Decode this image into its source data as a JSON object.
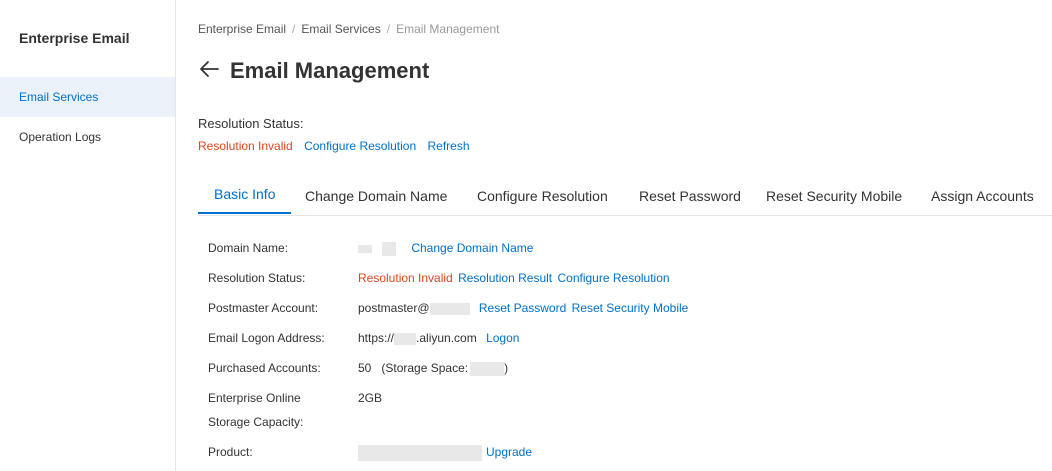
{
  "sidebar": {
    "title": "Enterprise Email",
    "items": [
      {
        "label": "Email Services"
      },
      {
        "label": "Operation Logs"
      }
    ]
  },
  "breadcrumb": [
    "Enterprise Email",
    "Email Services",
    "Email Management"
  ],
  "page": {
    "title": "Email Management"
  },
  "resolution": {
    "label": "Resolution Status:",
    "status": "Resolution Invalid",
    "configure": "Configure Resolution",
    "refresh": "Refresh"
  },
  "tabs": [
    "Basic Info",
    "Change Domain Name",
    "Configure Resolution",
    "Reset Password",
    "Reset Security Mobile",
    "Assign Accounts"
  ],
  "info": {
    "domain_label": "Domain Name:",
    "domain_action": "Change Domain Name",
    "res_label": "Resolution Status:",
    "res_status": "Resolution Invalid",
    "res_result": "Resolution Result",
    "res_configure": "Configure Resolution",
    "postmaster_label": "Postmaster Account:",
    "postmaster_prefix": "postmaster@",
    "reset_password": "Reset Password",
    "reset_mobile": "Reset Security Mobile",
    "logon_label": "Email Logon Address:",
    "logon_prefix": "https://",
    "logon_suffix": ".aliyun.com",
    "logon_action": "Logon",
    "purchased_label": "Purchased Accounts:",
    "purchased_count": "50",
    "storage_space_prefix": "(Storage Space:",
    "storage_space_suffix": ")",
    "online_label_1": "Enterprise Online",
    "online_label_2": "Storage Capacity:",
    "online_value": "2GB",
    "product_label": "Product:",
    "product_action": "Upgrade"
  },
  "colors": {
    "accent": "#0070cc",
    "danger": "#e2451c",
    "active_bg": "#ebf1f8"
  }
}
